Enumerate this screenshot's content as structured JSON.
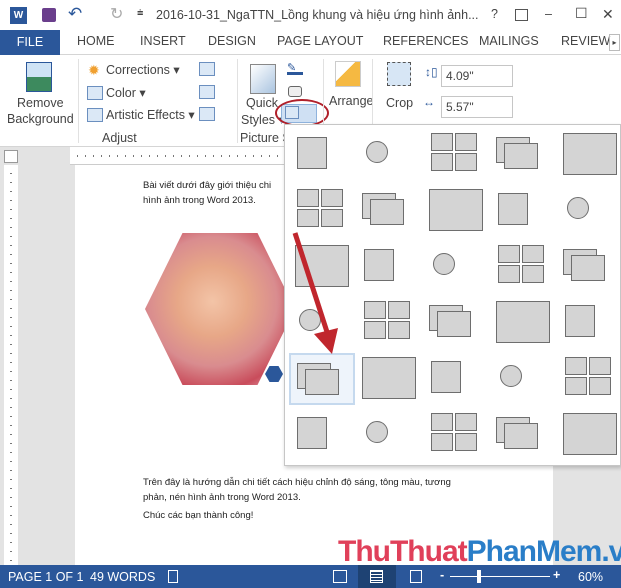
{
  "titlebar": {
    "title": "2016-10-31_NgaTTN_Lồng khung và hiệu ứng hình ảnh...",
    "help": "?",
    "minimize": "–",
    "maximize": "☐",
    "close": "✕"
  },
  "tabs": [
    "FILE",
    "HOME",
    "INSERT",
    "DESIGN",
    "PAGE LAYOUT",
    "REFERENCES",
    "MAILINGS",
    "REVIEW"
  ],
  "ribbon": {
    "remove_bg_1": "Remove",
    "remove_bg_2": "Background",
    "corrections": "Corrections ▾",
    "color": "Color ▾",
    "artistic": "Artistic Effects ▾",
    "adjust_group": "Adjust",
    "quick_1": "Quick",
    "quick_2": "Styles ▾",
    "picture_styles_group": "Picture S",
    "arrange": "Arrange",
    "crop": "Crop",
    "height": "4.09\"",
    "width": "5.57\""
  },
  "document": {
    "intro_1": "Bài viết dưới đây giới thiệu chi",
    "intro_2": "hình ảnh trong Word 2013.",
    "outro_1": "Trên đây là hướng dẫn chi tiết cách hiệu chỉnh độ sáng, tông màu, tương",
    "outro_2": "phản, nén hình ảnh trong Word 2013.",
    "outro_3": "Chúc các bạn thành công!"
  },
  "gallery": {
    "name": "picture-layout-gallery",
    "rows": 6,
    "cols": 5,
    "selected_row": 5,
    "selected_col": 1
  },
  "watermark": {
    "part1": "ThuThuat",
    "part2": "PhanMem",
    "part3": ".vn",
    "color1": "#e0405a",
    "color2": "#2a7ec8"
  },
  "status": {
    "page": "PAGE 1 OF 1",
    "words": "49 WORDS",
    "zoom": "60%",
    "zoom_level": 60
  },
  "colors": {
    "accent": "#2b579a",
    "highlight_circle": "#b0202a",
    "arrow": "#c0262d"
  }
}
